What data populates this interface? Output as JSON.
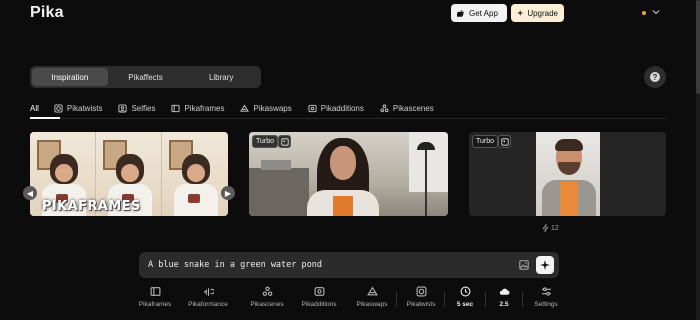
{
  "header": {
    "logo": "Pika",
    "get_app_label": "Get App",
    "upgrade_label": "Upgrade",
    "status_color": "#e6a63a"
  },
  "main_tabs": [
    {
      "label": "Inspiration",
      "active": true
    },
    {
      "label": "Pikaffects",
      "active": false
    },
    {
      "label": "Library",
      "active": false
    }
  ],
  "help_label": "?",
  "categories": [
    {
      "label": "All",
      "icon": "none",
      "active": true
    },
    {
      "label": "Pikatwists",
      "icon": "twist-icon",
      "active": false
    },
    {
      "label": "Selfies",
      "icon": "selfie-icon",
      "active": false
    },
    {
      "label": "Pikaframes",
      "icon": "frames-icon",
      "active": false
    },
    {
      "label": "Pikaswaps",
      "icon": "swap-icon",
      "active": false
    },
    {
      "label": "Pikadditions",
      "icon": "additions-icon",
      "active": false
    },
    {
      "label": "Pikascenes",
      "icon": "scenes-icon",
      "active": false
    }
  ],
  "gallery": {
    "card1": {
      "overlay_title": "PIKAFRAMES"
    },
    "card2": {
      "badge": "Turbo"
    },
    "card3": {
      "badge": "Turbo"
    },
    "likes": "12"
  },
  "prompt": {
    "value": "A blue snake in a green water pond"
  },
  "toolbar": [
    {
      "label": "Pikaframes",
      "icon": "pikaframes-icon",
      "strong": false
    },
    {
      "label": "Pikaformance",
      "icon": "pikaformance-icon",
      "strong": false
    },
    {
      "label": "Pikascenes",
      "icon": "pikascenes-icon",
      "strong": false
    },
    {
      "label": "Pikadditions",
      "icon": "pikadditions-icon",
      "strong": false
    },
    {
      "label": "Pikaswaps",
      "icon": "pikaswaps-icon",
      "strong": false
    },
    {
      "label": "Pikatwists",
      "icon": "pikatwists-icon",
      "strong": false
    },
    {
      "label": "5 sec",
      "icon": "clock-icon",
      "strong": true
    },
    {
      "label": "2.5",
      "icon": "cloud-icon",
      "strong": true
    },
    {
      "label": "Settings",
      "icon": "settings-icon",
      "strong": false
    }
  ]
}
